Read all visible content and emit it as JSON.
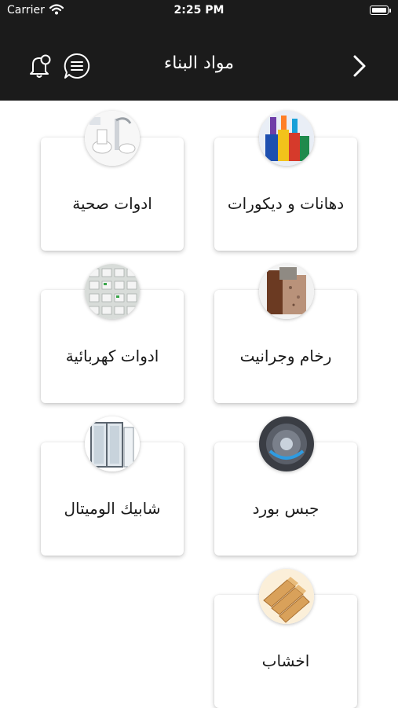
{
  "status_bar": {
    "carrier": "Carrier",
    "time": "2:25 PM"
  },
  "header": {
    "title": "مواد البناء",
    "icons": [
      "chevron-right-icon",
      "chat-icon",
      "bell-icon"
    ],
    "background": "#1b1b1b"
  },
  "categories": [
    {
      "label": "دهانات و ديكورات",
      "icon": "paint-icon"
    },
    {
      "label": "ادوات صحية",
      "icon": "sanitary-icon"
    },
    {
      "label": "رخام وجرانيت",
      "icon": "marble-icon"
    },
    {
      "label": "ادوات كهربائية",
      "icon": "electrical-icon"
    },
    {
      "label": "جبس بورد",
      "icon": "gypsum-icon"
    },
    {
      "label": "شابيك الوميتال",
      "icon": "aluminium-window-icon"
    },
    {
      "label": "اخشاب",
      "icon": "wood-icon"
    }
  ]
}
